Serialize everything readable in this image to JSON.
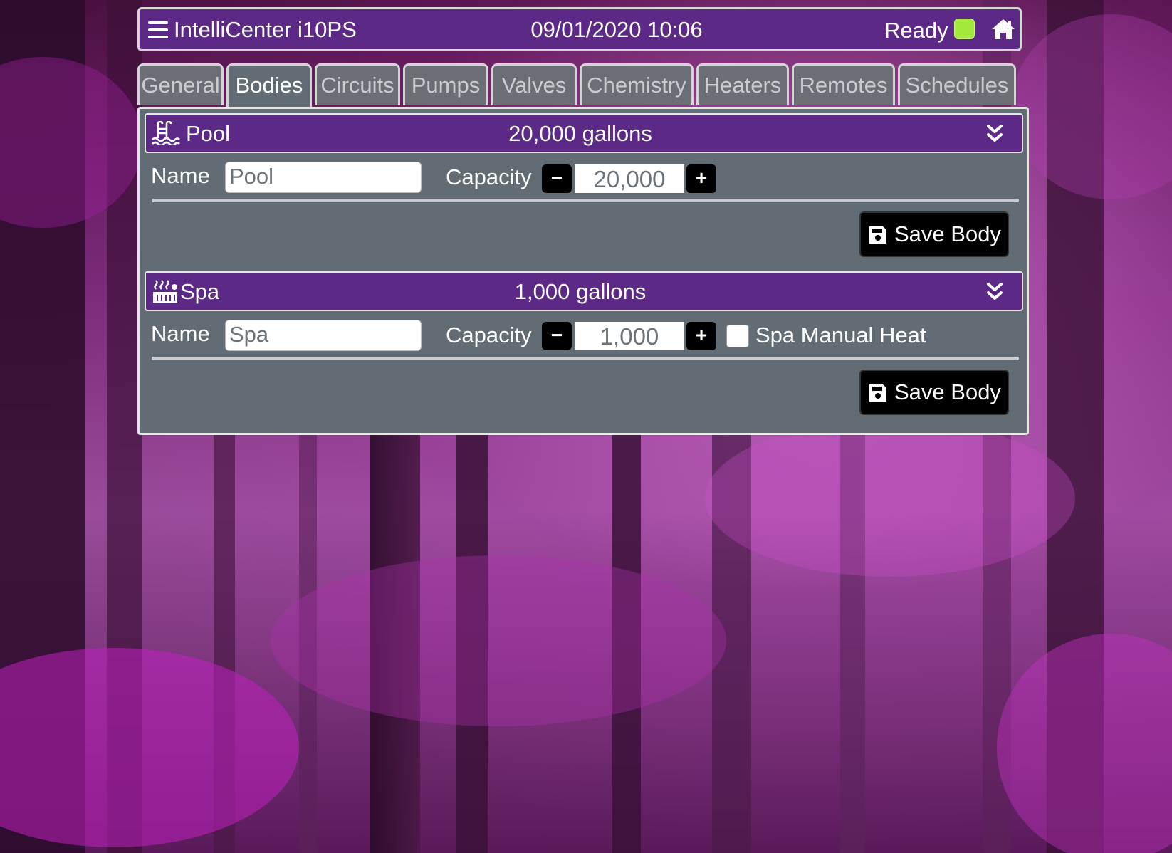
{
  "header": {
    "title": "IntelliCenter i10PS",
    "datetime": "09/01/2020 10:06",
    "status": "Ready",
    "status_color": "#a3e83a"
  },
  "tabs": [
    {
      "label": "General",
      "active": false
    },
    {
      "label": "Bodies",
      "active": true
    },
    {
      "label": "Circuits",
      "active": false
    },
    {
      "label": "Pumps",
      "active": false
    },
    {
      "label": "Valves",
      "active": false
    },
    {
      "label": "Chemistry",
      "active": false
    },
    {
      "label": "Heaters",
      "active": false
    },
    {
      "label": "Remotes",
      "active": false
    },
    {
      "label": "Schedules",
      "active": false
    }
  ],
  "bodies": [
    {
      "name": "Pool",
      "capacity_label": "20,000 gallons",
      "icon": "pool-icon",
      "name_field_label": "Name",
      "name_value": "Pool",
      "capacity_field_label": "Capacity",
      "capacity_value": "20,000",
      "minus_label": "−",
      "plus_label": "+",
      "save_label": "Save Body"
    },
    {
      "name": "Spa",
      "capacity_label": "1,000 gallons",
      "icon": "spa-icon",
      "name_field_label": "Name",
      "name_value": "Spa",
      "capacity_field_label": "Capacity",
      "capacity_value": "1,000",
      "minus_label": "−",
      "plus_label": "+",
      "manual_heat_label": "Spa Manual Heat",
      "manual_heat_checked": false,
      "save_label": "Save Body"
    }
  ],
  "colors": {
    "header_bg": "#5c2a86",
    "panel_bg": "#626c74",
    "tab_bg": "#6b6f75"
  }
}
